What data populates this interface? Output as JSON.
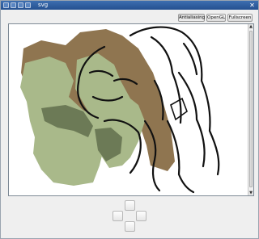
{
  "window": {
    "title": "svg"
  },
  "toolbar": {
    "antialiasing_label": "Antialiasing",
    "opengl_label": "OpenGL",
    "fullscreen_label": "Fullscreen"
  },
  "colors": {
    "title_bar": "#2f5f9f",
    "skin_green": "#a9b98a",
    "hair_brown": "#8f7550",
    "line_black": "#111111"
  },
  "scroll": {
    "up_arrow": "▲",
    "down_arrow": "▼"
  },
  "nav_pad": [
    "pan-up-button",
    "pan-left-button",
    "pan-right-button",
    "pan-down-button"
  ]
}
